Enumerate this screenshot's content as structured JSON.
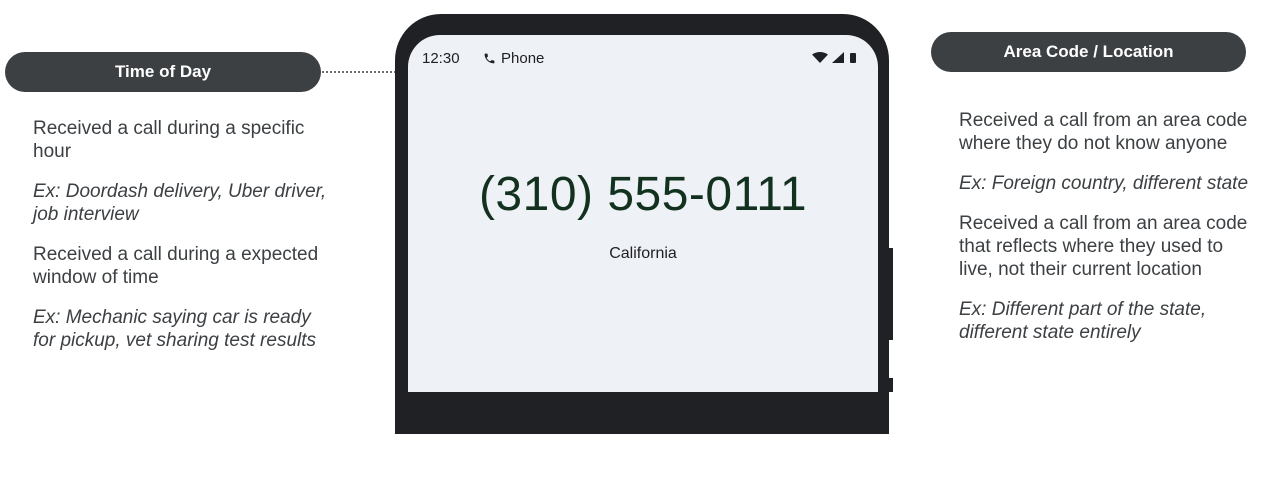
{
  "left": {
    "title": "Time of Day",
    "items": [
      "Received a call during a specific hour",
      "Ex: Doordash delivery, Uber driver, job interview",
      "Received a call during a expected window of time",
      "Ex: Mechanic saying car is ready for pickup, vet sharing test results"
    ]
  },
  "right": {
    "title": "Area Code / Location",
    "items": [
      "Received a call from an area code where they do not know anyone",
      "Ex: Foreign country, different state",
      "Received a call from an area code that reflects where they used to live, not their current location",
      "Ex: Different part of the state, different state entirely"
    ]
  },
  "phone": {
    "status_time": "12:30",
    "status_app": "Phone",
    "number": "(310) 555-0111",
    "location": "California",
    "icons": [
      "phone-icon",
      "wifi-icon",
      "signal-icon",
      "battery-icon"
    ]
  },
  "colors": {
    "pill": "#3c4043",
    "phone_frame": "#202124",
    "screen": "#eef1f6",
    "number": "#12321f"
  }
}
